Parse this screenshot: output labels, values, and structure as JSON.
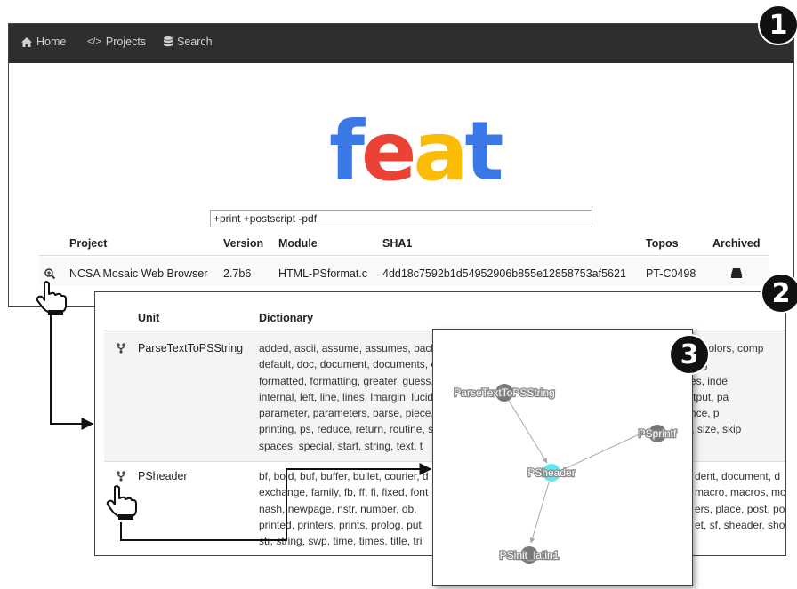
{
  "navbar": {
    "items": [
      {
        "label": "Home",
        "icon": "home-icon"
      },
      {
        "label": "Projects",
        "icon": "code-icon"
      },
      {
        "label": "Search",
        "icon": "database-icon"
      }
    ]
  },
  "logo": {
    "letters": [
      {
        "char": "f",
        "color": "#3b78e7"
      },
      {
        "char": "e",
        "color": "#ea4335"
      },
      {
        "char": "a",
        "color": "#fbbc05"
      },
      {
        "char": "t",
        "color": "#3b78e7"
      }
    ]
  },
  "search": {
    "value": "+print +postscript -pdf"
  },
  "projects_table": {
    "headers": {
      "project": "Project",
      "version": "Version",
      "module": "Module",
      "sha1": "SHA1",
      "topos": "Topos",
      "archived": "Archived"
    },
    "rows": [
      {
        "project": "NCSA Mosaic Web Browser",
        "version": "2.7b6",
        "module": "HTML-PSformat.c",
        "sha1": "4dd18c7592b1d54952906b855e12858753af5621",
        "topos": "PT-C0498",
        "archived_icon": "drive-icon",
        "action_icon": "zoom-icon"
      }
    ]
  },
  "units_table": {
    "headers": {
      "unit": "Unit",
      "dictionary": "Dictionary"
    },
    "rows": [
      {
        "unit": "ParseTextToPSString",
        "icon": "fork-icon",
        "dictionary": [
          "added, ascii, assume, assumes, background, black, bottom, calculate, century, charset, code, colors, comp",
          "default, doc, document, documents, encoding, endif, fail, family, font, fontbase, fontfamily, foreg",
          "formatted, formatting, greater, guess, header, headers, height, hmm, html, ifdef, inch, includes, inde",
          "internal, left, line, lines, lmargin, lucida, mark, margin, maximum, minimum, new, number, output, pa",
          "parameter, parameters, parse, piece, pixel, pixels, point, points, postscript, practice, preference, p",
          "printing, ps, reduce, return, routine, save, scale, screen, section, setup, setfont, setup, show, size, skip",
          "spaces, special, start, string, text, t"
        ]
      },
      {
        "unit": "PSheader",
        "icon": "fork-icon",
        "dictionary": [
          "bf, bold, buf, buffer, bullet, courier, d",
          "exchange, family, fb, ff, fi, fixed, font",
          "nash, newpage, nstr, number, ob,",
          "printed, printers, prints, prolog, put",
          "str, string, swp, time, times, title, tri"
        ],
        "dictionary_right": [
          "dent, document, d",
          "macro, macros, mo",
          "ers, place, post, po",
          "et, sf, sheader, sho"
        ]
      }
    ]
  },
  "graph": {
    "nodes": [
      {
        "label": "ParseTextToPSString",
        "color": "#777777"
      },
      {
        "label": "PSprintf",
        "color": "#777777"
      },
      {
        "label": "PSheader",
        "color": "#5ee8f0"
      },
      {
        "label": "PSinit_latin1",
        "color": "#777777"
      }
    ]
  },
  "badges": {
    "one": "1",
    "two": "2",
    "three": "3"
  }
}
